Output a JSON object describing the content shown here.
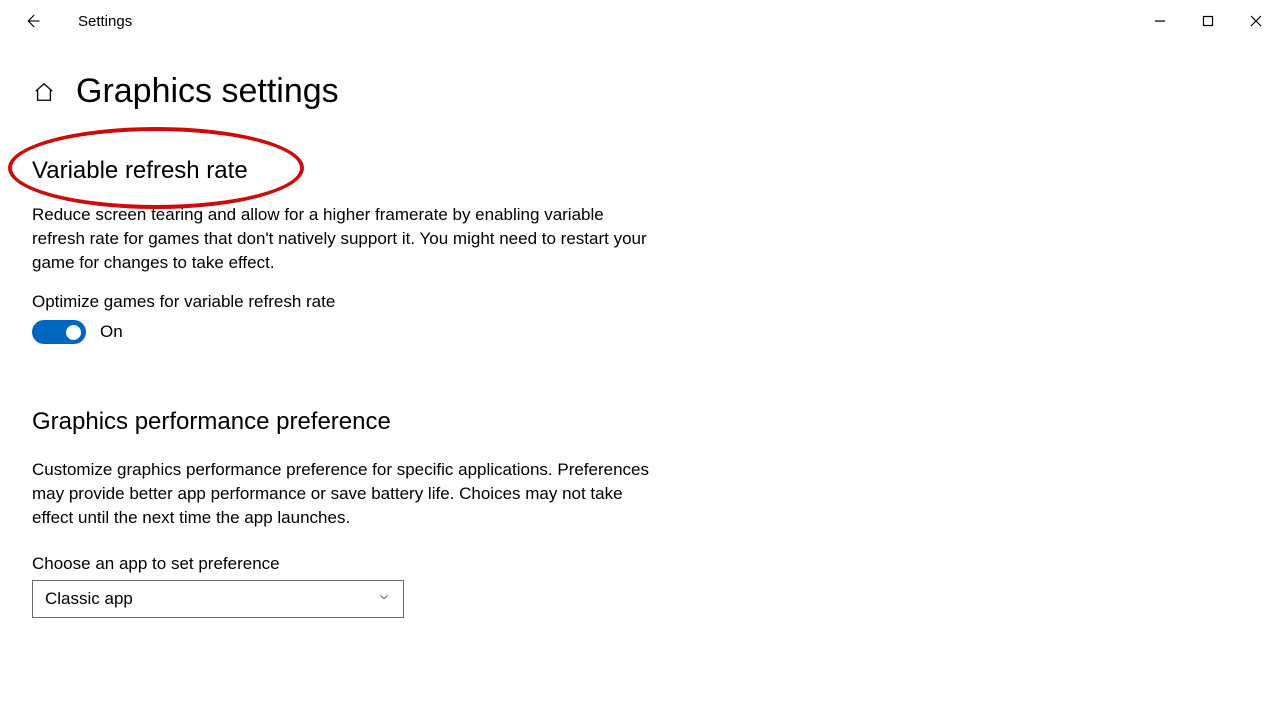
{
  "titlebar": {
    "app_name": "Settings"
  },
  "page": {
    "title": "Graphics settings"
  },
  "section_vrr": {
    "heading": "Variable refresh rate",
    "description": "Reduce screen tearing and allow for a higher framerate by enabling variable refresh rate for games that don't natively support it. You might need to restart your game for changes to take effect.",
    "toggle_label": "Optimize games for variable refresh rate",
    "toggle_state": "On"
  },
  "section_perf": {
    "heading": "Graphics performance preference",
    "description": "Customize graphics performance preference for specific applications. Preferences may provide better app performance or save battery life. Choices may not take effect until the next time the app launches.",
    "choose_label": "Choose an app to set preference",
    "dropdown_value": "Classic app"
  }
}
